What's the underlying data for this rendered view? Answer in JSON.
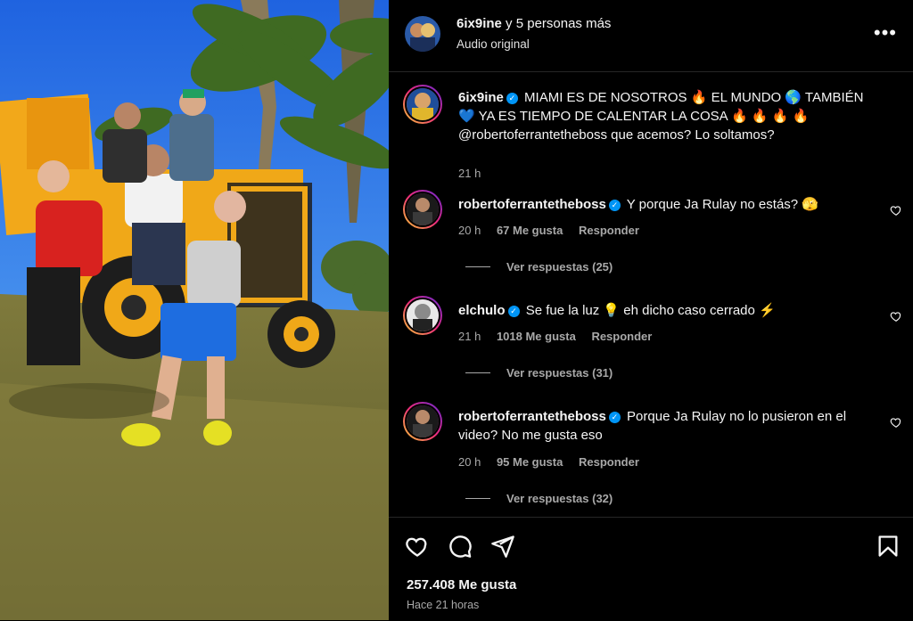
{
  "header": {
    "account": "6ix9ine",
    "others": "y 5 personas más",
    "subtitle": "Audio original",
    "more_label": "•••"
  },
  "caption": {
    "user": "6ix9ine",
    "text_line1": "MIAMI ES DE NOSOTROS 🔥 EL MUNDO 🌎 TAMBIÉN",
    "text_line2": "💙 YA ES TIEMPO DE CALENTAR LA COSA 🔥 🔥 🔥 🔥",
    "text_line3": "@robertoferrantetheboss que acemos? Lo soltamos?",
    "time": "21 h"
  },
  "comments": [
    {
      "user": "robertoferrantetheboss",
      "text": "Y porque Ja Rulay no estás? 🫣",
      "time": "20 h",
      "likes": "67 Me gusta",
      "reply": "Responder",
      "view_replies": "Ver respuestas (25)"
    },
    {
      "user": "elchulo",
      "text": "Se fue la luz 💡 eh dicho caso cerrado ⚡",
      "time": "21 h",
      "likes": "1018 Me gusta",
      "reply": "Responder",
      "view_replies": "Ver respuestas (31)"
    },
    {
      "user": "robertoferrantetheboss",
      "text": "Porque Ja Rulay no lo pusieron en el video? No me gusta eso",
      "time": "20 h",
      "likes": "95 Me gusta",
      "reply": "Responder",
      "view_replies": "Ver respuestas (32)"
    }
  ],
  "footer": {
    "likes": "257.408 Me gusta",
    "ago": "Hace 21 horas"
  },
  "icons": {
    "like": "heart-icon",
    "comment": "comment-icon",
    "share": "share-icon",
    "save": "bookmark-icon",
    "more": "more-icon"
  },
  "colors": {
    "background": "#000000",
    "verified": "#0095f6",
    "muted_text": "#a8a8a8",
    "divider": "#262626"
  }
}
